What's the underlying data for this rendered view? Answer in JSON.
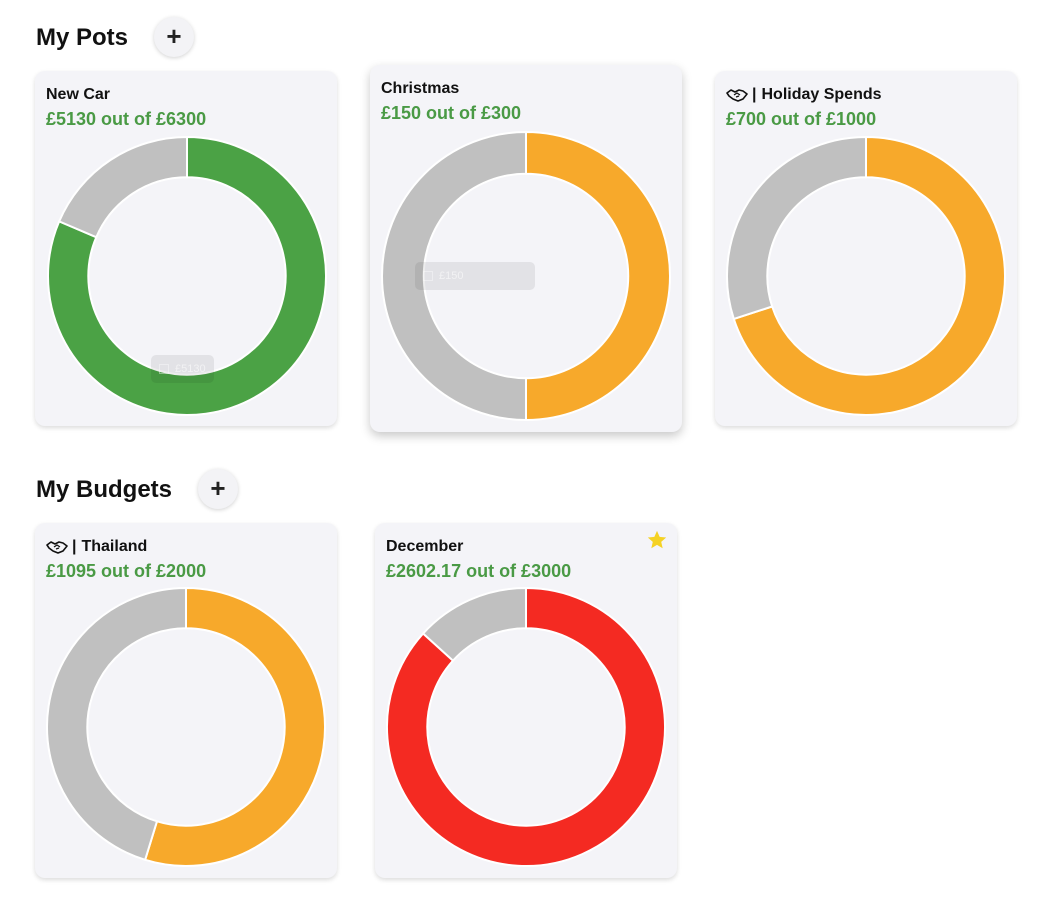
{
  "pots_section": {
    "title": "My Pots",
    "add_label": "+"
  },
  "budgets_section": {
    "title": "My Budgets",
    "add_label": "+"
  },
  "colors": {
    "gray": "#c0c0c0",
    "green": "#4ba245",
    "orange": "#f7a92b",
    "red": "#f42a22",
    "amount_text": "#4a9a45",
    "star": "#f5d224"
  },
  "pots": [
    {
      "name": "New Car",
      "amount": "£5130 out of £6300",
      "saved": 5130,
      "target": 6300,
      "fill_color": "#4ba245",
      "shared": false,
      "tooltip": "£5130"
    },
    {
      "name": "Christmas",
      "amount": "£150 out of £300",
      "saved": 150,
      "target": 300,
      "fill_color": "#f7a92b",
      "shared": false,
      "tooltip": "£150"
    },
    {
      "name": "Holiday Spends",
      "amount": "£700 out of £1000",
      "saved": 700,
      "target": 1000,
      "fill_color": "#f7a92b",
      "shared": true,
      "separator": "|"
    }
  ],
  "budgets": [
    {
      "name": "Thailand",
      "amount": "£1095 out of £2000",
      "spent": 1095,
      "limit": 2000,
      "fill_color": "#f7a92b",
      "shared": true,
      "separator": "|"
    },
    {
      "name": "December",
      "amount": "£2602.17 out of £3000",
      "spent": 2602.17,
      "limit": 3000,
      "fill_color": "#f42a22",
      "shared": false,
      "starred": true
    }
  ]
}
